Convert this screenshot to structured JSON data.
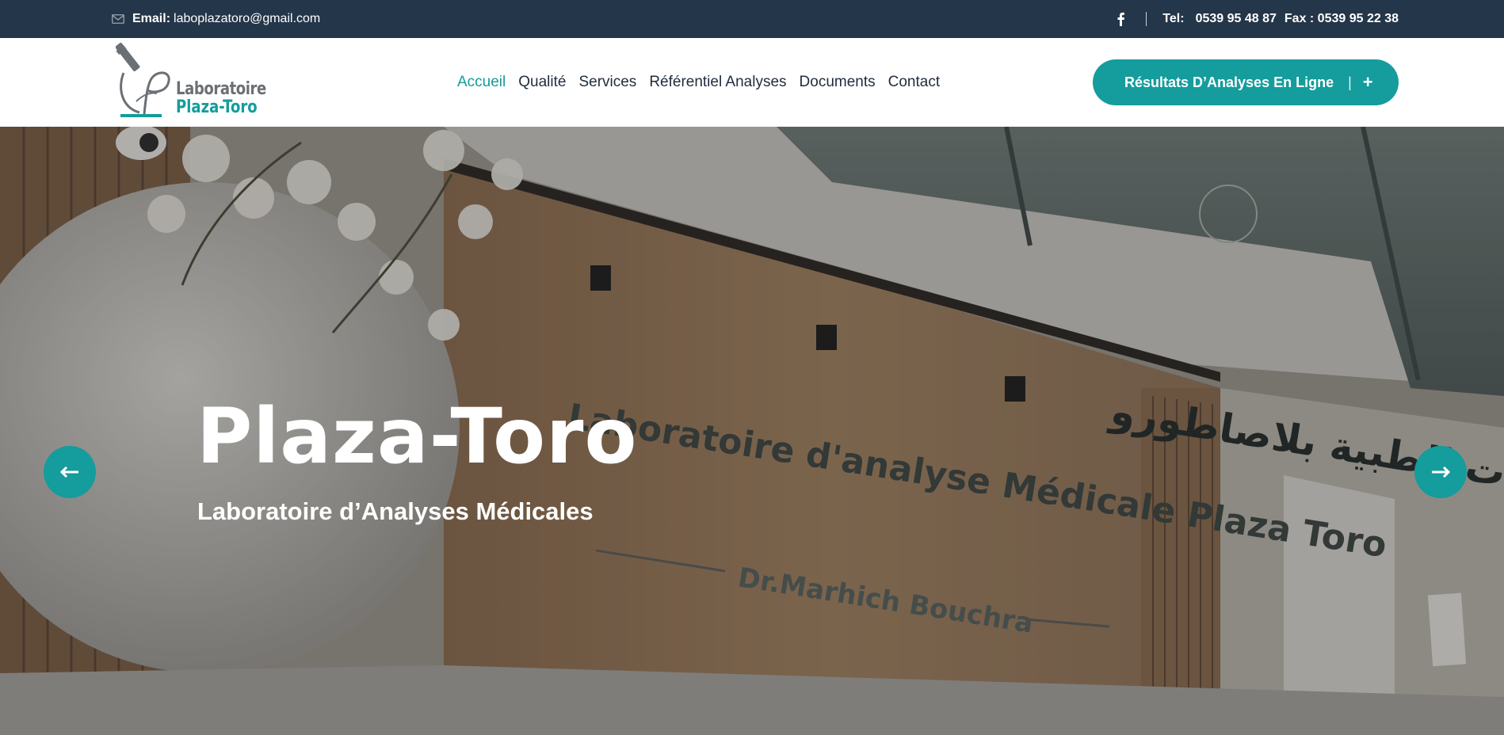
{
  "topbar": {
    "email_label": "Email:",
    "email": "laboplazatoro@gmail.com",
    "tel_label": "Tel:",
    "tel": "0539 95 48 87",
    "fax": "Fax : 0539 95 22 38",
    "facebook_icon": "facebook-icon",
    "mail_icon": "envelope-icon"
  },
  "logo": {
    "line1": "Laboratoire",
    "line2": "Plaza-Toro"
  },
  "nav": {
    "items": [
      {
        "label": "Accueil",
        "active": true
      },
      {
        "label": "Qualité"
      },
      {
        "label": "Services"
      },
      {
        "label": "Référentiel Analyses"
      },
      {
        "label": "Documents"
      },
      {
        "label": "Contact"
      }
    ]
  },
  "cta": {
    "label": "Résultats D’Analyses En Ligne",
    "separator": "|",
    "plus": "+"
  },
  "hero": {
    "title": "Plaza-Toro",
    "subtitle": "Laboratoire d’Analyses Médicales",
    "sign_arabic": "مختبر التحليلات الطبية بلاصاطورو",
    "sign_fr": "Laboratoire d'analyse Médicale Plaza Toro",
    "sign_doctor": "Dr.Marhich Bouchra",
    "window_stamp": "مختبر التحليلات الطبية"
  },
  "colors": {
    "accent": "#159c9c",
    "topbar": "#243649",
    "nav_text": "#1f2d3d"
  }
}
